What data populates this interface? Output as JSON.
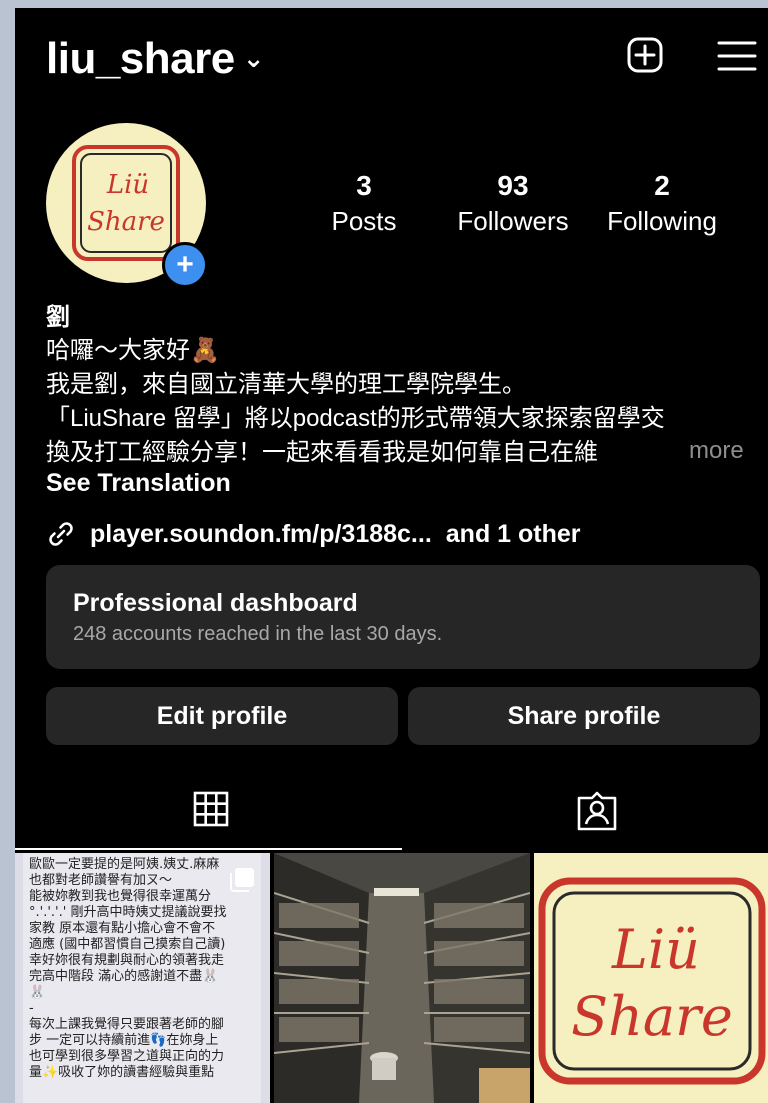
{
  "header": {
    "username": "liu_share",
    "chevron": "⌄"
  },
  "avatar": {
    "line1": "Liü",
    "line2": "Share",
    "add_label": "+"
  },
  "stats": [
    {
      "value": "3",
      "label": "Posts"
    },
    {
      "value": "93",
      "label": "Followers"
    },
    {
      "value": "2",
      "label": "Following"
    }
  ],
  "bio": {
    "name": "劉",
    "lines": [
      "哈囉～大家好🧸",
      "我是劉，來自國立清華大學的理工學院學生。",
      "「LiuShare 留學」將以podcast的形式帶領大家探索留學交",
      "換及打工經驗分享！一起來看看我是如何靠自己在維"
    ],
    "more": "more",
    "see_translation": "See Translation"
  },
  "link": {
    "url": "player.soundon.fm/p/3188c...",
    "extra": "and 1 other"
  },
  "dashboard": {
    "title": "Professional dashboard",
    "subtitle": "248 accounts reached in the last 30 days."
  },
  "buttons": {
    "edit": "Edit profile",
    "share": "Share profile"
  },
  "post1_text": [
    "歐歐一定要提的是阿姨.姨丈.麻麻",
    "也都對老師讚譽有加ㄡ～",
    "能被妳教到我也覺得很幸運萬分",
    "°.'.'.'.' 剛升高中時姨丈提議說要找",
    "家教 原本還有點小擔心會不會不",
    "適應 (國中都習慣自己摸索自己讀)",
    "幸好妳很有規劃與耐心的領著我走",
    "完高中階段 滿心的感謝道不盡🐰",
    "🐰",
    "-",
    "每次上課我覺得只要跟著老師的腳",
    "步 一定可以持續前進👣在妳身上",
    "也可學到很多學習之道與正向的力",
    "量✨吸收了妳的讀書經驗與重點"
  ],
  "post3": {
    "line1": "Liü",
    "line2": "Share"
  },
  "colors": {
    "background": "#000000",
    "card": "#262626",
    "accent": "#3d8ff0",
    "muted": "#a8a8a8",
    "logo_bg": "#f6efbf",
    "logo_red": "#c9372c"
  },
  "icons": [
    "plus-square-icon",
    "hamburger-menu-icon",
    "link-icon",
    "grid-icon",
    "tagged-person-icon",
    "multiple-posts-icon"
  ]
}
